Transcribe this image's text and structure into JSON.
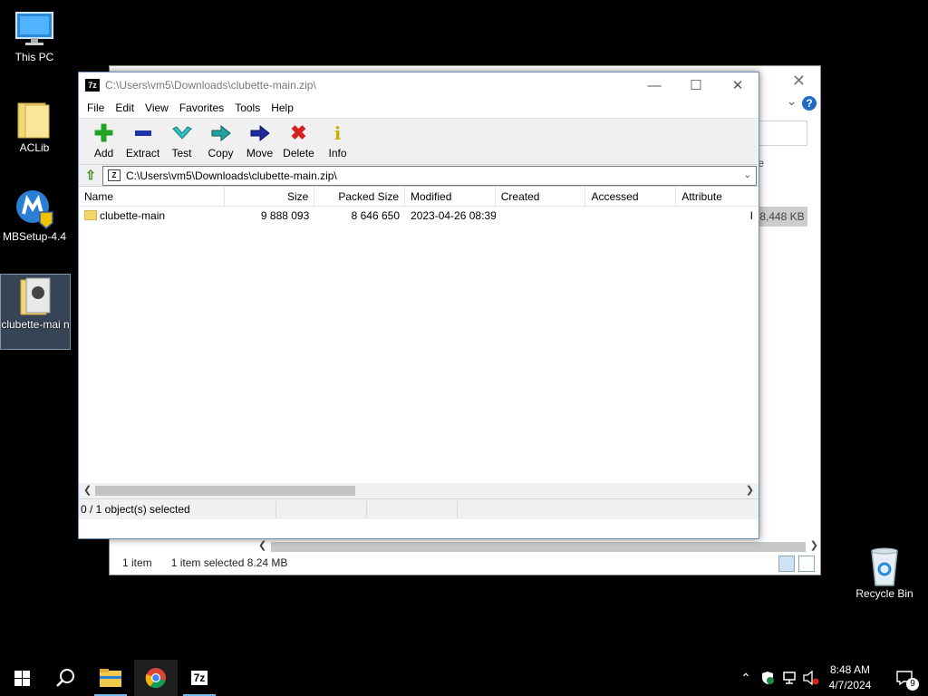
{
  "desktop": {
    "icons": [
      {
        "label": "This PC"
      },
      {
        "label": "ACLib"
      },
      {
        "label": "MBSetup-4.4"
      },
      {
        "label": "clubette-mai n"
      }
    ],
    "recycle_bin": "Recycle Bin"
  },
  "explorer": {
    "right_partial_letter": "e",
    "size_cell": "8,448 KB",
    "status": {
      "count": "1 item",
      "selected": "1 item selected  8.24 MB"
    }
  },
  "sevenzip": {
    "app_icon_text": "7z",
    "title": "C:\\Users\\vm5\\Downloads\\clubette-main.zip\\",
    "menu": [
      "File",
      "Edit",
      "View",
      "Favorites",
      "Tools",
      "Help"
    ],
    "toolbar": [
      {
        "label": "Add",
        "icon": "plus-icon",
        "color": "#22a422"
      },
      {
        "label": "Extract",
        "icon": "minus-icon",
        "color": "#1f33a8"
      },
      {
        "label": "Test",
        "icon": "check-icon",
        "color": "#27b3b3"
      },
      {
        "label": "Copy",
        "icon": "arrow-right-icon",
        "color": "#1f8a8a"
      },
      {
        "label": "Move",
        "icon": "arrow-right-icon",
        "color": "#1f2a8a"
      },
      {
        "label": "Delete",
        "icon": "x-icon",
        "color": "#d42020"
      },
      {
        "label": "Info",
        "icon": "info-icon",
        "color": "#d8c21a"
      }
    ],
    "address": "C:\\Users\\vm5\\Downloads\\clubette-main.zip\\",
    "columns": [
      "Name",
      "Size",
      "Packed Size",
      "Modified",
      "Created",
      "Accessed",
      "Attribute"
    ],
    "rows": [
      {
        "name": "clubette-main",
        "size": "9 888 093",
        "packed": "8 646 650",
        "modified": "2023-04-26 08:39",
        "created": "",
        "accessed": "",
        "attr": "I"
      }
    ],
    "status": "0 / 1 object(s) selected"
  },
  "taskbar": {
    "time": "8:48 AM",
    "date": "4/7/2024",
    "notification_count": "9",
    "pinned_7z": "7z"
  }
}
